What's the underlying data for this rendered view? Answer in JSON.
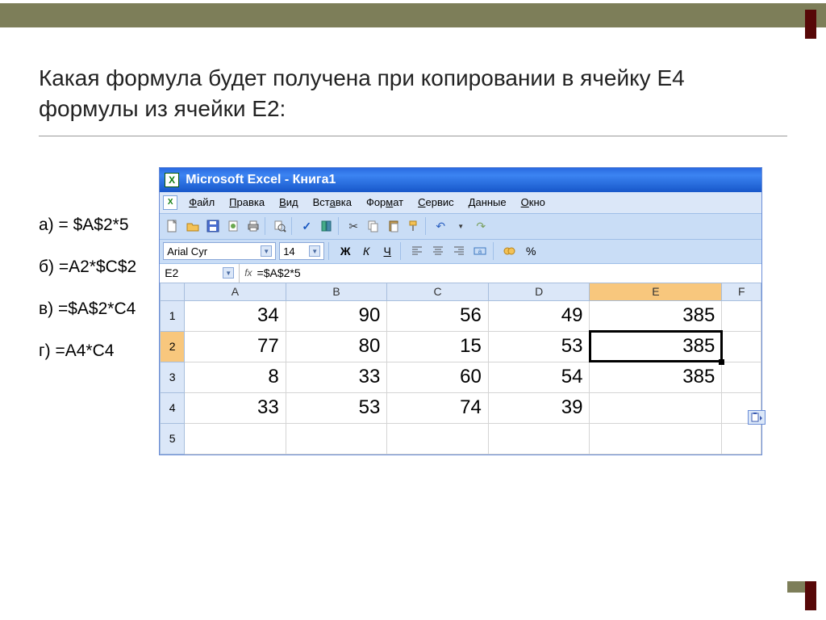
{
  "question": "Какая формула будет получена при копировании в ячейку Е4 формулы из ячейки Е2:",
  "options": {
    "a": "а) = $A$2*5",
    "b": "б) =A2*$C$2",
    "v": "в) =$A$2*C4",
    "g": "г) =A4*C4"
  },
  "excel": {
    "title": "Microsoft Excel - Книга1",
    "menu": [
      "Файл",
      "Правка",
      "Вид",
      "Вставка",
      "Формат",
      "Сервис",
      "Данные",
      "Окно"
    ],
    "menu_ul_index": [
      0,
      0,
      0,
      3,
      3,
      0,
      0,
      0
    ],
    "font_name": "Arial Cyr",
    "font_size": "14",
    "name_box": "E2",
    "formula": "=$A$2*5",
    "fx_label": "fx",
    "columns": [
      "A",
      "B",
      "C",
      "D",
      "E",
      "F"
    ],
    "rows": [
      "1",
      "2",
      "3",
      "4",
      "5"
    ],
    "cells": [
      [
        "34",
        "90",
        "56",
        "49",
        "385",
        ""
      ],
      [
        "77",
        "80",
        "15",
        "53",
        "385",
        ""
      ],
      [
        "8",
        "33",
        "60",
        "54",
        "385",
        ""
      ],
      [
        "33",
        "53",
        "74",
        "39",
        "",
        ""
      ],
      [
        "",
        "",
        "",
        "",
        "",
        ""
      ]
    ],
    "selected_cell": "E2",
    "format_labels": {
      "bold": "Ж",
      "italic": "К",
      "underline": "Ч",
      "percent": "%"
    }
  }
}
